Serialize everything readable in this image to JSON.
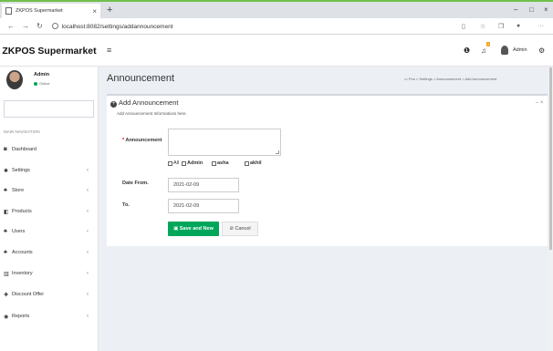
{
  "browser": {
    "tab_title": "ZKPOS Supermarket",
    "tab_close": "×",
    "new_tab": "+",
    "url": "localhost:8082/settings/addannouncement",
    "back": "←",
    "forward": "→",
    "reload": "↻",
    "minimize": "–",
    "maximize": "□",
    "close": "×",
    "more": "···"
  },
  "header": {
    "logo": "ZKPOS Supermarket",
    "menu_toggle": "≡",
    "notification_count": "2",
    "user": "Admin"
  },
  "sidebar": {
    "user_name": "Admin",
    "user_status": "Online",
    "nav_header": "MAIN NAVIGATION",
    "items": [
      {
        "label": "Dashboard",
        "icon": "dashboard-icon",
        "glyph": "◙"
      },
      {
        "label": "Settings",
        "icon": "settings-icon",
        "glyph": "✱"
      },
      {
        "label": "Store",
        "icon": "store-icon",
        "glyph": "♣"
      },
      {
        "label": "Products",
        "icon": "products-icon",
        "glyph": "◧"
      },
      {
        "label": "Users",
        "icon": "users-icon",
        "glyph": "♣"
      },
      {
        "label": "Accounts",
        "icon": "accounts-icon",
        "glyph": "♣"
      },
      {
        "label": "Inventory",
        "icon": "inventory-icon",
        "glyph": "▥"
      },
      {
        "label": "Discount Offer",
        "icon": "discount-icon",
        "glyph": "✚"
      },
      {
        "label": "Reports",
        "icon": "reports-icon",
        "glyph": "◉"
      }
    ],
    "chevron": "‹"
  },
  "page": {
    "title": "Announcement",
    "breadcrumb": "Pos > Settings > Announcement > Add Announcement"
  },
  "box": {
    "title": "Add Announcement",
    "subtitle": "Add Announcement Informations here.",
    "tools": "–  ×"
  },
  "form": {
    "announcement_label": "Announcement",
    "required_mark": "*",
    "checkboxes": [
      {
        "label": "All"
      },
      {
        "label": "Admin"
      },
      {
        "label": "asha"
      },
      {
        "label": "akhil"
      }
    ],
    "date_from_label": "Date From.",
    "date_from_value": "2021-02-09",
    "to_label": "To.",
    "to_value": "2021-02-09",
    "save_button": "Save and New",
    "cancel_button": "Cancel"
  },
  "colors": {
    "accent_green": "#00a65a",
    "sidebar_bg": "#ffffff",
    "content_bg": "#ecf0f5",
    "tab_accent": "#6fc04a"
  }
}
